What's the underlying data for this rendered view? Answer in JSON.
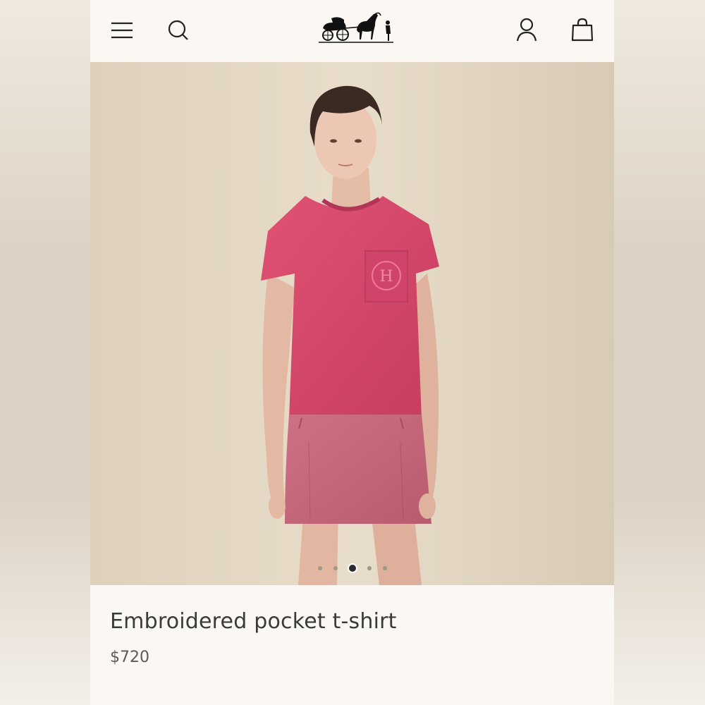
{
  "header": {
    "menu_icon": "hamburger-menu-icon",
    "search_icon": "search-icon",
    "logo": "carriage-logo",
    "account_icon": "user-icon",
    "cart_icon": "shopping-bag-icon"
  },
  "gallery": {
    "image": "model-wearing-pink-tshirt-and-leather-skirt",
    "slide_count": 5,
    "active_slide": 3
  },
  "product": {
    "title": "Embroidered pocket t-shirt",
    "price": "$720"
  },
  "colors": {
    "page_bg": "#fbf8f3",
    "tshirt": "#d8486a",
    "skirt": "#c8677a",
    "backdrop": "#e2d6c1",
    "text": "#3a3a3a"
  }
}
